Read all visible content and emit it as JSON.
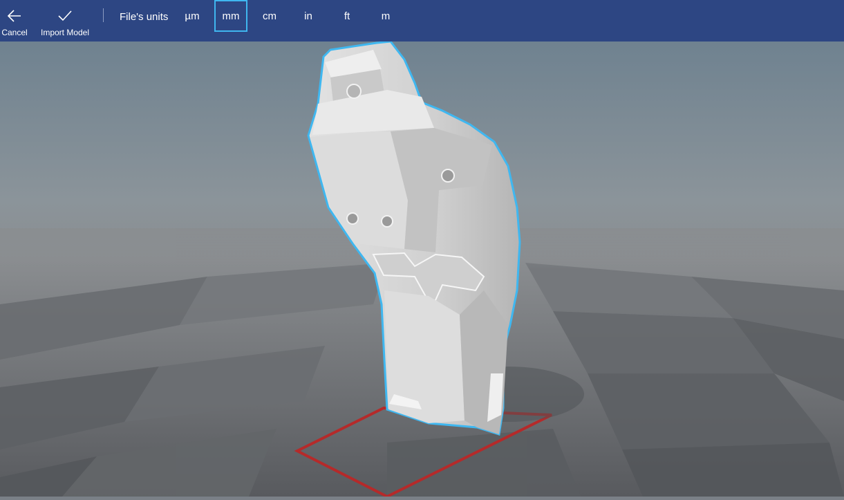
{
  "toolbar": {
    "cancel_label": "Cancel",
    "cancel_icon": "back-arrow-icon",
    "import_label": "Import Model",
    "import_icon": "checkmark-icon",
    "units_label": "File's units",
    "units": [
      {
        "label": "µm",
        "selected": false
      },
      {
        "label": "mm",
        "selected": true
      },
      {
        "label": "cm",
        "selected": false
      },
      {
        "label": "in",
        "selected": false
      },
      {
        "label": "ft",
        "selected": false
      },
      {
        "label": "m",
        "selected": false
      }
    ]
  },
  "colors": {
    "toolbar_bg": "#2d4683",
    "selection_outline": "#3fb7f0",
    "build_plate_outline": "#b52a2a",
    "model_fill": "#d6d6d6"
  }
}
